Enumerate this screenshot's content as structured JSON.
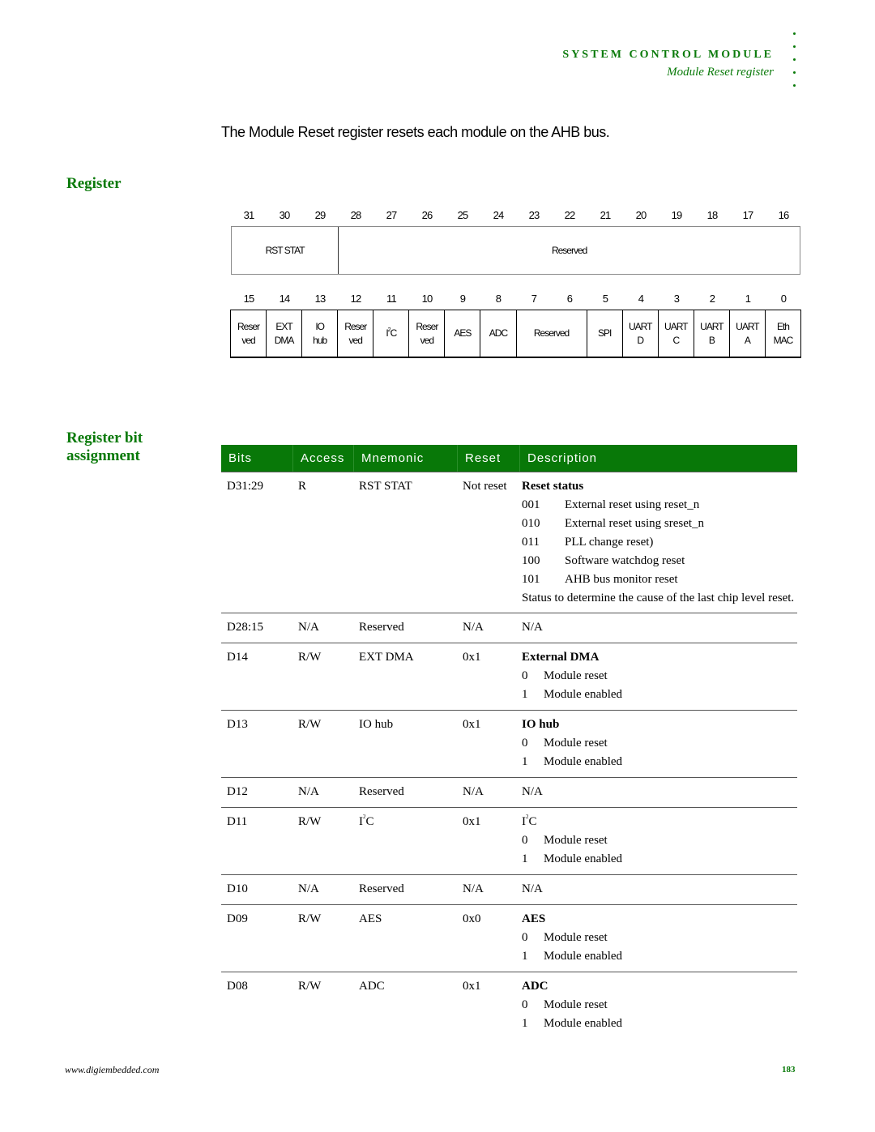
{
  "header": {
    "section": "SYSTEM CONTROL MODULE",
    "subtitle": "Module Reset register"
  },
  "intro": "The Module Reset register resets each module on the AHB bus.",
  "headings": {
    "register": "Register",
    "assignment_line1": "Register bit",
    "assignment_line2": "assignment"
  },
  "register": {
    "high_bits": [
      "31",
      "30",
      "29",
      "28",
      "27",
      "26",
      "25",
      "24",
      "23",
      "22",
      "21",
      "20",
      "19",
      "18",
      "17",
      "16"
    ],
    "low_bits": [
      "15",
      "14",
      "13",
      "12",
      "11",
      "10",
      "9",
      "8",
      "7",
      "6",
      "5",
      "4",
      "3",
      "2",
      "1",
      "0"
    ],
    "high_fields": [
      {
        "label": "RST STAT",
        "span": 3
      },
      {
        "label": "Reserved",
        "span": 13
      }
    ],
    "low_fields": [
      {
        "line1": "Reser",
        "line2": "ved",
        "span": 1
      },
      {
        "line1": "EXT",
        "line2": "DMA",
        "span": 1
      },
      {
        "line1": "IO",
        "line2": "hub",
        "span": 1
      },
      {
        "line1": "Reser",
        "line2": "ved",
        "span": 1
      },
      {
        "line1": "I",
        "sup": "2",
        "line1b": "C",
        "span": 1
      },
      {
        "line1": "Reser",
        "line2": "ved",
        "span": 1
      },
      {
        "line1": "AES",
        "span": 1
      },
      {
        "line1": "ADC",
        "span": 1
      },
      {
        "line1": "Reserved",
        "span": 2
      },
      {
        "line1": "SPI",
        "span": 1
      },
      {
        "line1": "UART",
        "line2": "D",
        "span": 1
      },
      {
        "line1": "UART",
        "line2": "C",
        "span": 1
      },
      {
        "line1": "UART",
        "line2": "B",
        "span": 1
      },
      {
        "line1": "UART",
        "line2": "A",
        "span": 1
      },
      {
        "line1": "Eth",
        "line2": "MAC",
        "span": 1
      }
    ]
  },
  "table": {
    "columns": [
      "Bits",
      "Access",
      "Mnemonic",
      "Reset",
      "Description"
    ],
    "rows": [
      {
        "bits": "D31:29",
        "access": "R",
        "mnemonic": "RST STAT",
        "reset": "Not reset",
        "desc_title": "Reset status",
        "desc_bold": true,
        "codes": [
          {
            "k": "001",
            "v": "External reset using reset_n"
          },
          {
            "k": "010",
            "v": "External reset using sreset_n"
          },
          {
            "k": "011",
            "v": "PLL change reset)"
          },
          {
            "k": "100",
            "v": "Software watchdog reset"
          },
          {
            "k": "101",
            "v": "AHB bus monitor reset"
          }
        ],
        "para": "Status to determine the cause of the last chip level reset."
      },
      {
        "bits": "D28:15",
        "access": "N/A",
        "mnemonic": "Reserved",
        "reset": "N/A",
        "desc_title": "N/A",
        "desc_bold": false
      },
      {
        "bits": "D14",
        "access": "R/W",
        "mnemonic": "EXT DMA",
        "reset": "0x1",
        "desc_title": "External DMA",
        "desc_bold": true,
        "codes": [
          {
            "k": "0",
            "v": "Module reset"
          },
          {
            "k": "1",
            "v": "Module enabled"
          }
        ]
      },
      {
        "bits": "D13",
        "access": "R/W",
        "mnemonic": "IO hub",
        "reset": "0x1",
        "desc_title": "IO hub",
        "desc_bold": true,
        "codes": [
          {
            "k": "0",
            "v": "Module reset"
          },
          {
            "k": "1",
            "v": "Module enabled"
          }
        ]
      },
      {
        "bits": "D12",
        "access": "N/A",
        "mnemonic": "Reserved",
        "reset": "N/A",
        "desc_title": "N/A",
        "desc_bold": false
      },
      {
        "bits": "D11",
        "access": "R/W",
        "mnemonic_base": "I",
        "mnemonic_sup": "2",
        "mnemonic_tail": "C",
        "reset": "0x1",
        "desc_base": "I",
        "desc_sup": "2",
        "desc_tail": "C",
        "desc_bold": false,
        "codes": [
          {
            "k": "0",
            "v": "Module reset"
          },
          {
            "k": "1",
            "v": "Module enabled"
          }
        ]
      },
      {
        "bits": "D10",
        "access": "N/A",
        "mnemonic": "Reserved",
        "reset": "N/A",
        "desc_title": "N/A",
        "desc_bold": false
      },
      {
        "bits": "D09",
        "access": "R/W",
        "mnemonic": "AES",
        "reset": "0x0",
        "desc_title": "AES",
        "desc_bold": true,
        "codes": [
          {
            "k": "0",
            "v": "Module reset"
          },
          {
            "k": "1",
            "v": "Module enabled"
          }
        ]
      },
      {
        "bits": "D08",
        "access": "R/W",
        "mnemonic": "ADC",
        "reset": "0x1",
        "desc_title": "ADC",
        "desc_bold": true,
        "codes": [
          {
            "k": "0",
            "v": "Module reset"
          },
          {
            "k": "1",
            "v": "Module enabled"
          }
        ]
      }
    ]
  },
  "footer": {
    "url": "www.digiembedded.com",
    "page": "183"
  },
  "colors": {
    "accent_green": "#0a7a0a",
    "table_header_bg": "#087808"
  }
}
